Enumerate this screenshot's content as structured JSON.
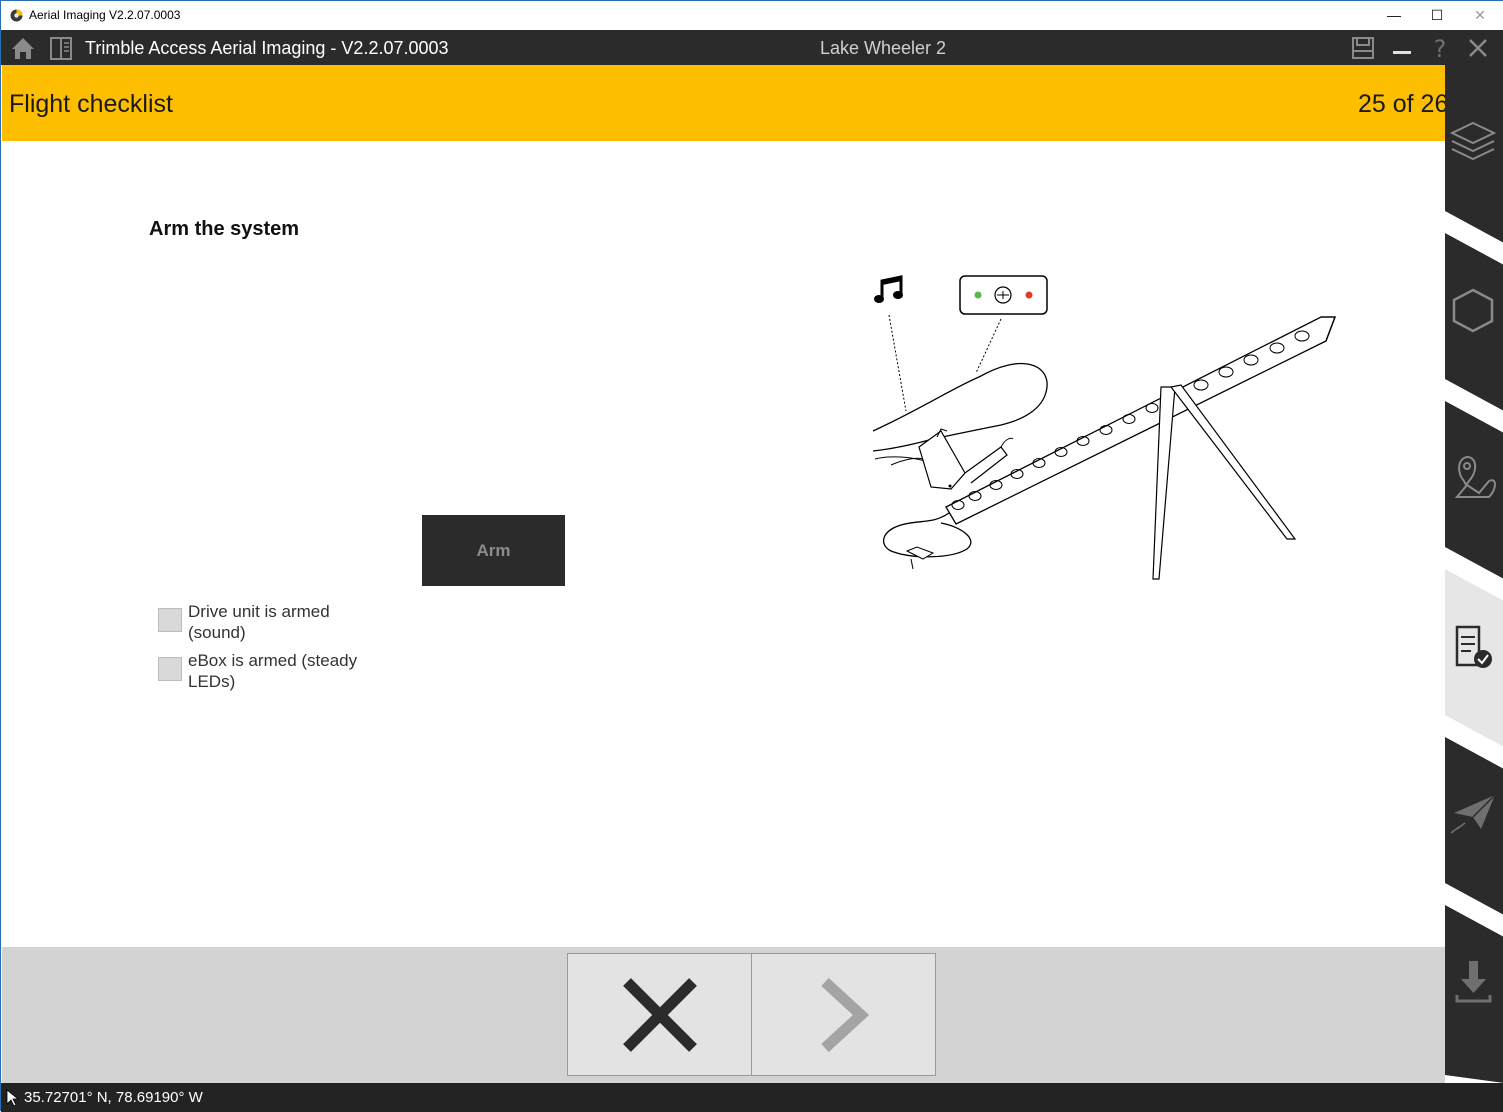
{
  "os_window": {
    "title": "Aerial Imaging V2.2.07.0003",
    "minimize": "—",
    "maximize": "☐",
    "close": "✕"
  },
  "app_bar": {
    "title": "Trimble Access Aerial Imaging - V2.2.07.0003",
    "job_name": "Lake Wheeler 2"
  },
  "header": {
    "title": "Flight checklist",
    "counter": "25 of 26"
  },
  "step": {
    "title": "Arm the system",
    "arm_label": "Arm",
    "checklist": [
      {
        "label": "Drive unit is armed (sound)",
        "checked": false
      },
      {
        "label": "eBox is armed (steady LEDs)",
        "checked": false
      }
    ]
  },
  "rail": {
    "items": [
      {
        "icon": "layers-icon",
        "active": false
      },
      {
        "icon": "hexagon-icon",
        "active": false
      },
      {
        "icon": "map-pin-icon",
        "active": false
      },
      {
        "icon": "checklist-icon",
        "active": true
      },
      {
        "icon": "paper-plane-icon",
        "active": false
      },
      {
        "icon": "download-icon",
        "active": false
      }
    ]
  },
  "nav": {
    "cancel_icon": "close-icon",
    "next_icon": "chevron-right-icon"
  },
  "status": {
    "coordinates": "35.72701° N, 78.69190° W"
  },
  "colors": {
    "header": "#fdbe00",
    "app_bar": "#2b2b2b",
    "rail": "#2b2b2b",
    "bottom_band": "#d3d3d3"
  }
}
